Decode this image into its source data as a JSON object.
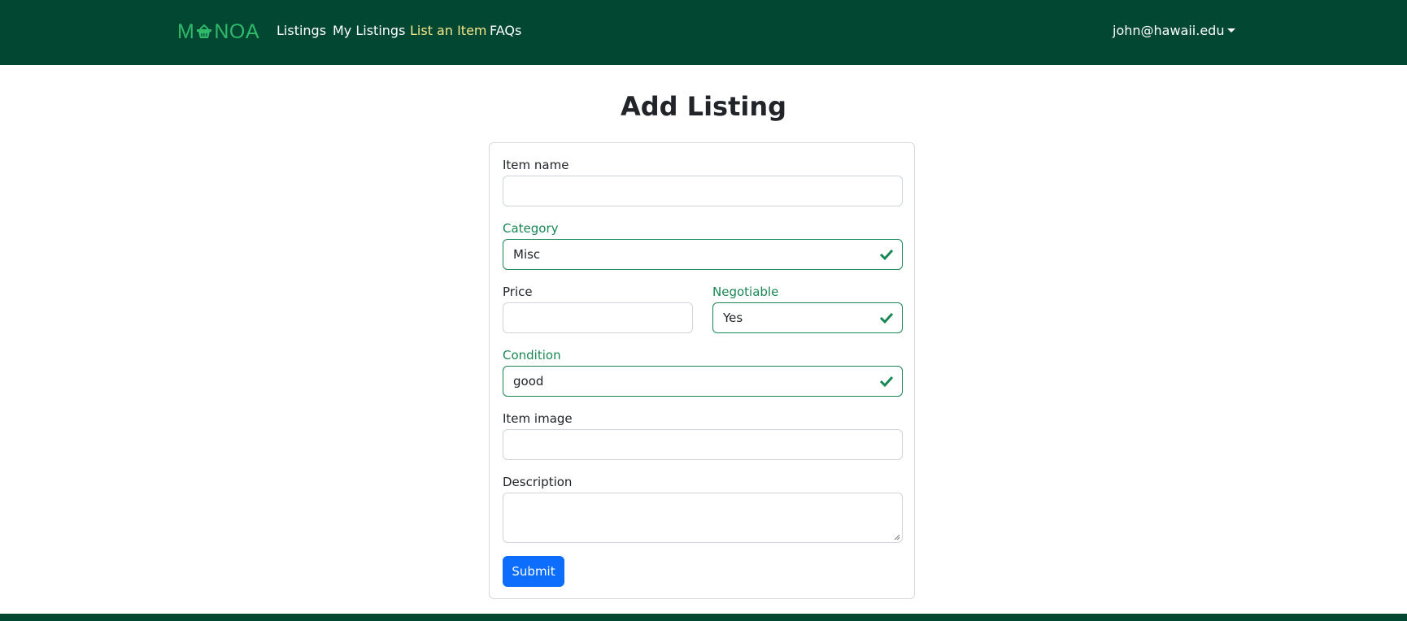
{
  "nav": {
    "brand": {
      "left": "M",
      "right": "NOA"
    },
    "links": [
      "Listings",
      "My Listings",
      "List an Item",
      "FAQs"
    ],
    "user": "john@hawaii.edu",
    "colors": {
      "bar": "#024731",
      "brand": "#2fba6a",
      "active_link": "#f5e68a"
    }
  },
  "page": {
    "title": "Add Listing"
  },
  "form": {
    "item_name": {
      "label": "Item name",
      "value": ""
    },
    "category": {
      "label": "Category",
      "value": "Misc"
    },
    "price": {
      "label": "Price",
      "value": ""
    },
    "negotiable": {
      "label": "Negotiable",
      "value": "Yes"
    },
    "condition": {
      "label": "Condition",
      "value": "good"
    },
    "item_image": {
      "label": "Item image",
      "value": ""
    },
    "description": {
      "label": "Description",
      "value": ""
    },
    "submit": "Submit",
    "colors": {
      "valid": "#198754",
      "submit": "#0d6efd"
    }
  }
}
